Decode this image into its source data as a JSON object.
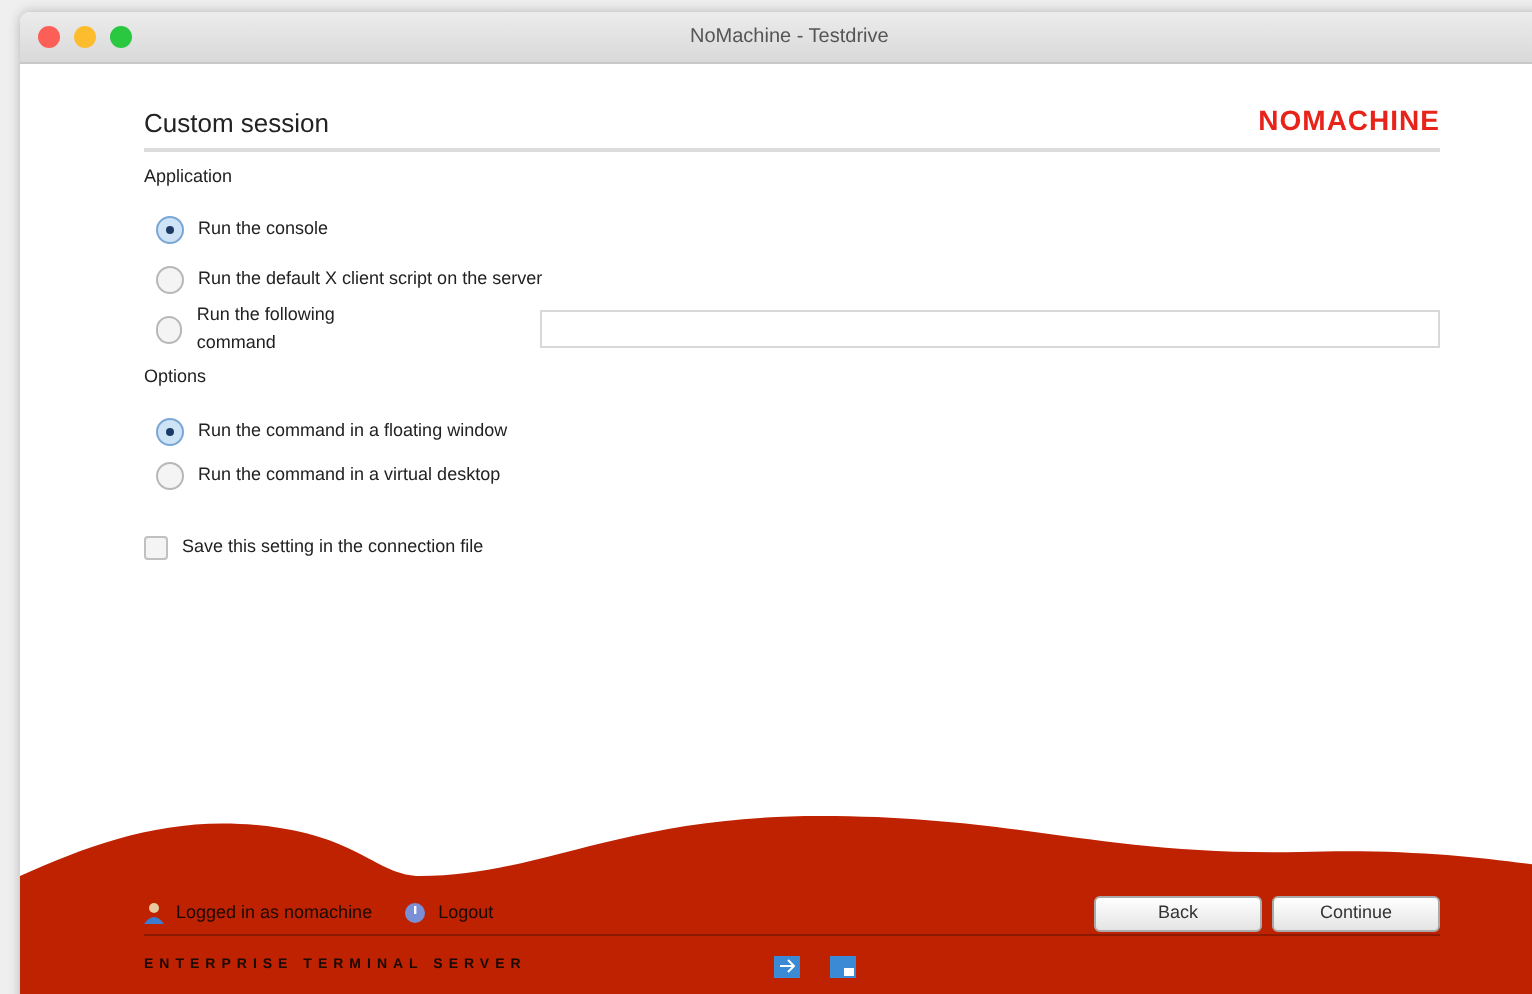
{
  "window": {
    "title": "NoMachine - Testdrive"
  },
  "header": {
    "title": "Custom session",
    "logo": "NOMACHINE"
  },
  "application": {
    "label": "Application",
    "options": [
      {
        "label": "Run the console",
        "selected": true
      },
      {
        "label": "Run the default X client script on the server",
        "selected": false
      },
      {
        "label": "Run the following command",
        "selected": false,
        "kind": "command"
      }
    ]
  },
  "options": {
    "label": "Options",
    "options": [
      {
        "label": "Run the command in a floating window",
        "selected": true
      },
      {
        "label": "Run the command in a virtual desktop",
        "selected": false
      }
    ]
  },
  "save_setting": {
    "label": "Save this setting in the connection file",
    "checked": false
  },
  "footer": {
    "user": "Logged in as nomachine",
    "logout": "Logout",
    "product": "ENTERPRISE TERMINAL SERVER",
    "buttons": [
      "Back",
      "Continue"
    ]
  }
}
